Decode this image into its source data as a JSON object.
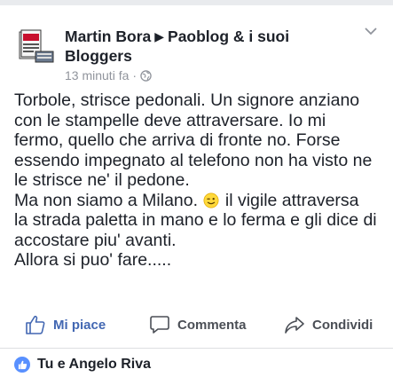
{
  "post": {
    "author": "Martin Bora",
    "group": "Paoblog & i suoi Bloggers",
    "timestamp": "13 minuti fa",
    "separator": "·",
    "privacy_icon": "globe-icon",
    "lines": [
      "Torbole, strisce pedonali. Un signore anziano",
      "con le stampelle deve attraversare. Io mi",
      "fermo, quello che arriva di fronte no. Forse",
      "essendo impegnato al telefono non ha visto ne",
      "le strisce ne' il pedone.",
      "Ma non siamo a Milano.",
      "il vigile attraversa",
      "la strada paletta in mano e lo ferma e gli dice di",
      "accostare piu' avanti.",
      "Allora si puo' fare....."
    ]
  },
  "actions": {
    "like": "Mi piace",
    "comment": "Commenta",
    "share": "Condividi"
  },
  "reactions": {
    "text": "Tu e Angelo Riva"
  },
  "colors": {
    "accent": "#4267b2",
    "text": "#1d2129",
    "meta": "#90949c",
    "like_badge": "#5890ff"
  }
}
